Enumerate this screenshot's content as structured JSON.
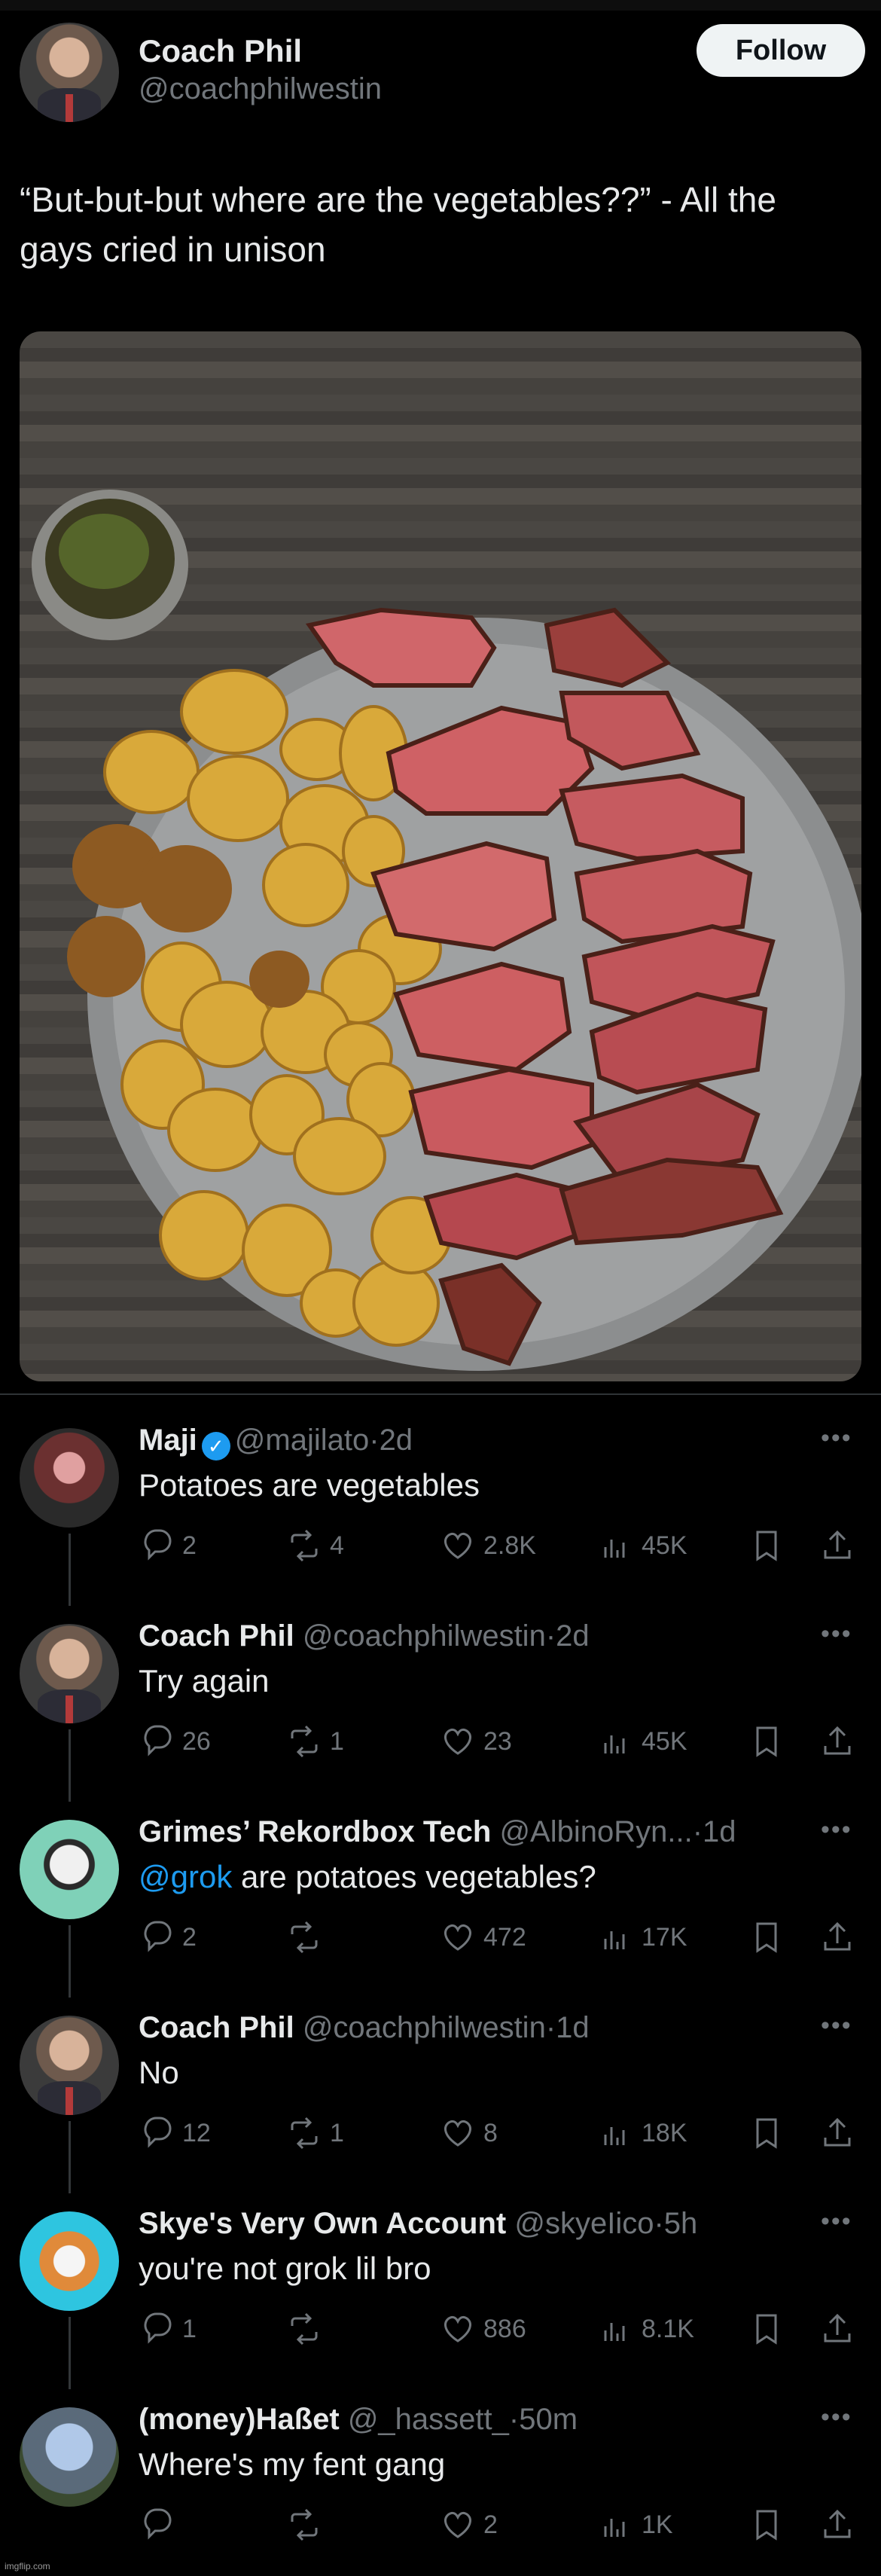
{
  "post": {
    "author_name": "Coach Phil",
    "author_handle": "@coachphilwestin",
    "follow_label": "Follow",
    "text": "“But-but-but where are the vegetables??” - All the gays cried in unison"
  },
  "replies": [
    {
      "name": "Maji",
      "verified": true,
      "handle": "@majilato",
      "time": "2d",
      "text": "Potatoes are vegetables",
      "mention": "",
      "replies": "2",
      "reposts": "4",
      "likes": "2.8K",
      "views": "45K"
    },
    {
      "name": "Coach Phil",
      "verified": false,
      "handle": "@coachphilwestin",
      "time": "2d",
      "text": "Try again",
      "mention": "",
      "replies": "26",
      "reposts": "1",
      "likes": "23",
      "views": "45K"
    },
    {
      "name": "Grimes’ Rekordbox Tech",
      "verified": false,
      "handle": "@AlbinoRyn...",
      "time": "1d",
      "text": " are potatoes vegetables?",
      "mention": "@grok",
      "replies": "2",
      "reposts": "",
      "likes": "472",
      "views": "17K"
    },
    {
      "name": "Coach Phil",
      "verified": false,
      "handle": "@coachphilwestin",
      "time": "1d",
      "text": "No",
      "mention": "",
      "replies": "12",
      "reposts": "1",
      "likes": "8",
      "views": "18K"
    },
    {
      "name": "Skye's Very Own Account",
      "verified": false,
      "handle": "@skyeIico",
      "time": "5h",
      "text": "you're not grok lil bro",
      "mention": "",
      "replies": "1",
      "reposts": "",
      "likes": "886",
      "views": "8.1K"
    },
    {
      "name": "(money)Haßet",
      "verified": false,
      "handle": "@_hassett_",
      "time": "50m",
      "text": "Where's my fent gang",
      "mention": "",
      "replies": "",
      "reposts": "",
      "likes": "2",
      "views": "1K"
    }
  ],
  "icons": {
    "reply": "reply-icon",
    "repost": "repost-icon",
    "like": "heart-icon",
    "views": "views-icon",
    "bookmark": "bookmark-icon",
    "share": "share-icon",
    "more": "more-icon"
  },
  "watermark": "imgflip.com",
  "colors": {
    "background": "#000000",
    "text": "#e7e9ea",
    "muted": "#71767b",
    "link": "#1d9bf0"
  }
}
